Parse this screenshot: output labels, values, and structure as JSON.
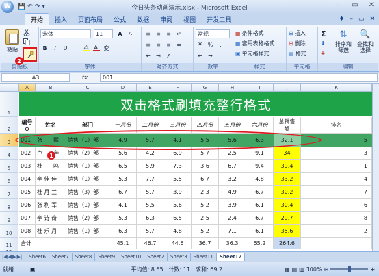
{
  "window": {
    "title": "今日头条动画演示.xlsx - Microsoft Excel",
    "orb_label": "W",
    "minimize": "–",
    "restore": "▭",
    "close": "✕"
  },
  "quick_access": [
    "💾",
    "↶",
    "↷",
    "▾"
  ],
  "tabs": [
    "开始",
    "插入",
    "页面布局",
    "公式",
    "数据",
    "审阅",
    "视图",
    "开发工具"
  ],
  "tabs_right": [
    "♦",
    "–",
    "▭",
    "✕"
  ],
  "ribbon": {
    "clipboard": {
      "paste": "粘贴",
      "group": "剪贴板"
    },
    "font": {
      "name": "宋体",
      "size": "11",
      "grow": "A",
      "shrink": "A",
      "bold": "B",
      "italic": "I",
      "underline": "U",
      "wen": "变",
      "group": "字体"
    },
    "alignment": {
      "group": "对齐方式"
    },
    "number": {
      "format": "常规",
      "group": "数字"
    },
    "styles": {
      "conditional": "条件格式",
      "table": "套用表格格式",
      "cell": "单元格样式",
      "group": "样式"
    },
    "cells": {
      "insert": "插入",
      "delete": "删除",
      "format": "格式",
      "group": "单元格"
    },
    "editing": {
      "sum": "Σ",
      "sort": "排序和筛选",
      "find": "查找和选择",
      "group": "编辑"
    }
  },
  "annotations": {
    "badge1": "1",
    "badge2": "2"
  },
  "formula_bar": {
    "name_box": "A3",
    "fx": "fx",
    "value": "001"
  },
  "sheet": {
    "columns": [
      "A",
      "B",
      "C",
      "D",
      "E",
      "F",
      "G",
      "H",
      "I",
      "J",
      "K"
    ],
    "banner": "双击格式刷填充整行格式",
    "headers": [
      "编号",
      "姓名",
      "部门",
      "一月份",
      "二月份",
      "三月份",
      "四月份",
      "五月份",
      "六月份",
      "总销售额",
      "排名"
    ],
    "rows": [
      {
        "num": "3",
        "cells": [
          "001",
          "张　　熙",
          "销售（1）部",
          "4.9",
          "5.7",
          "4.1",
          "5.5",
          "5.6",
          "6.3",
          "32.1",
          "5"
        ]
      },
      {
        "num": "4",
        "cells": [
          "002",
          "卢　　奔",
          "销售（2）部",
          "5.6",
          "4.2",
          "6.9",
          "5.7",
          "2.5",
          "9.1",
          "34",
          "3"
        ]
      },
      {
        "num": "5",
        "cells": [
          "003",
          "杜　　鸣",
          "销售（1）部",
          "6.5",
          "5.9",
          "7.3",
          "3.6",
          "6.7",
          "9.4",
          "39.4",
          "1"
        ]
      },
      {
        "num": "6",
        "cells": [
          "004",
          "李 佳 佳",
          "销售（1）部",
          "5.3",
          "7.7",
          "5.5",
          "6.7",
          "3.2",
          "4.8",
          "33.2",
          "4"
        ]
      },
      {
        "num": "7",
        "cells": [
          "005",
          "杜 月 兰",
          "销售（3）部",
          "6.7",
          "5.7",
          "3.9",
          "2.3",
          "4.9",
          "6.7",
          "30.2",
          "7"
        ]
      },
      {
        "num": "8",
        "cells": [
          "006",
          "张 利 军",
          "销售（1）部",
          "4.1",
          "5.5",
          "5.6",
          "5.2",
          "3.9",
          "6.1",
          "30.4",
          "6"
        ]
      },
      {
        "num": "9",
        "cells": [
          "007",
          "李 诗 奇",
          "销售（2）部",
          "5.3",
          "6.3",
          "6.5",
          "2.5",
          "2.4",
          "6.7",
          "29.7",
          "8"
        ]
      },
      {
        "num": "10",
        "cells": [
          "008",
          "杜 乐 月",
          "销售（1）部",
          "6.3",
          "5.7",
          "4.8",
          "5.2",
          "7.1",
          "6.1",
          "35.6",
          "2"
        ]
      }
    ],
    "total": {
      "num": "11",
      "label": "合计",
      "values": [
        "45.1",
        "46.7",
        "44.6",
        "36.7",
        "36.3",
        "55.2",
        "264.6"
      ]
    },
    "row_numbers": [
      "1",
      "2",
      "12"
    ]
  },
  "sheet_tabs": [
    "Sheet6",
    "Sheet7",
    "Sheet8",
    "Sheet9",
    "Sheet10",
    "Sheet2",
    "Sheet3",
    "Sheet11",
    "Sheet12"
  ],
  "sheet_tab_active": "Sheet12",
  "status": {
    "ready": "就绪",
    "average": "平均值: 8.65",
    "count": "计数: 11",
    "sum": "求和: 69.2",
    "zoom": "100%"
  },
  "colors": {
    "banner": "#1fa348",
    "highlight_row": "#41a564",
    "yellow": "#ffff00",
    "annotation_red": "#e0191f"
  }
}
